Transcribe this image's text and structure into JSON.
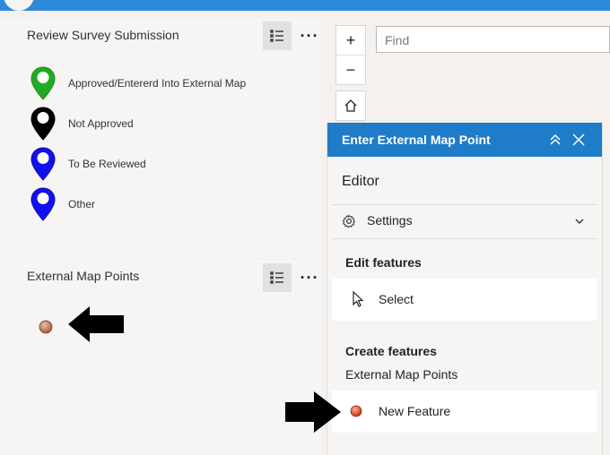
{
  "layers": [
    {
      "title": "Review Survey Submission",
      "legend": [
        {
          "label": "Approved/Entererd Into External Map",
          "color": "#22aa22"
        },
        {
          "label": "Not Approved",
          "color": "#000000"
        },
        {
          "label": "To Be Reviewed",
          "color": "#1111ee"
        },
        {
          "label": "Other",
          "color": "#1111ee"
        }
      ]
    },
    {
      "title": "External Map Points"
    }
  ],
  "map_controls": {
    "zoom_in": "+",
    "zoom_out": "−",
    "more": "···"
  },
  "search": {
    "placeholder": "Find"
  },
  "editor": {
    "header_title": "Enter External Map Point",
    "heading": "Editor",
    "settings_label": "Settings",
    "edit_features_heading": "Edit features",
    "select_label": "Select",
    "create_features_heading": "Create features",
    "layer_name": "External Map Points",
    "new_feature_label": "New Feature"
  },
  "colors": {
    "header_blue": "#1e7cc8",
    "topbar_blue": "#2c8ad8",
    "feature_dot": "#d8452a"
  }
}
